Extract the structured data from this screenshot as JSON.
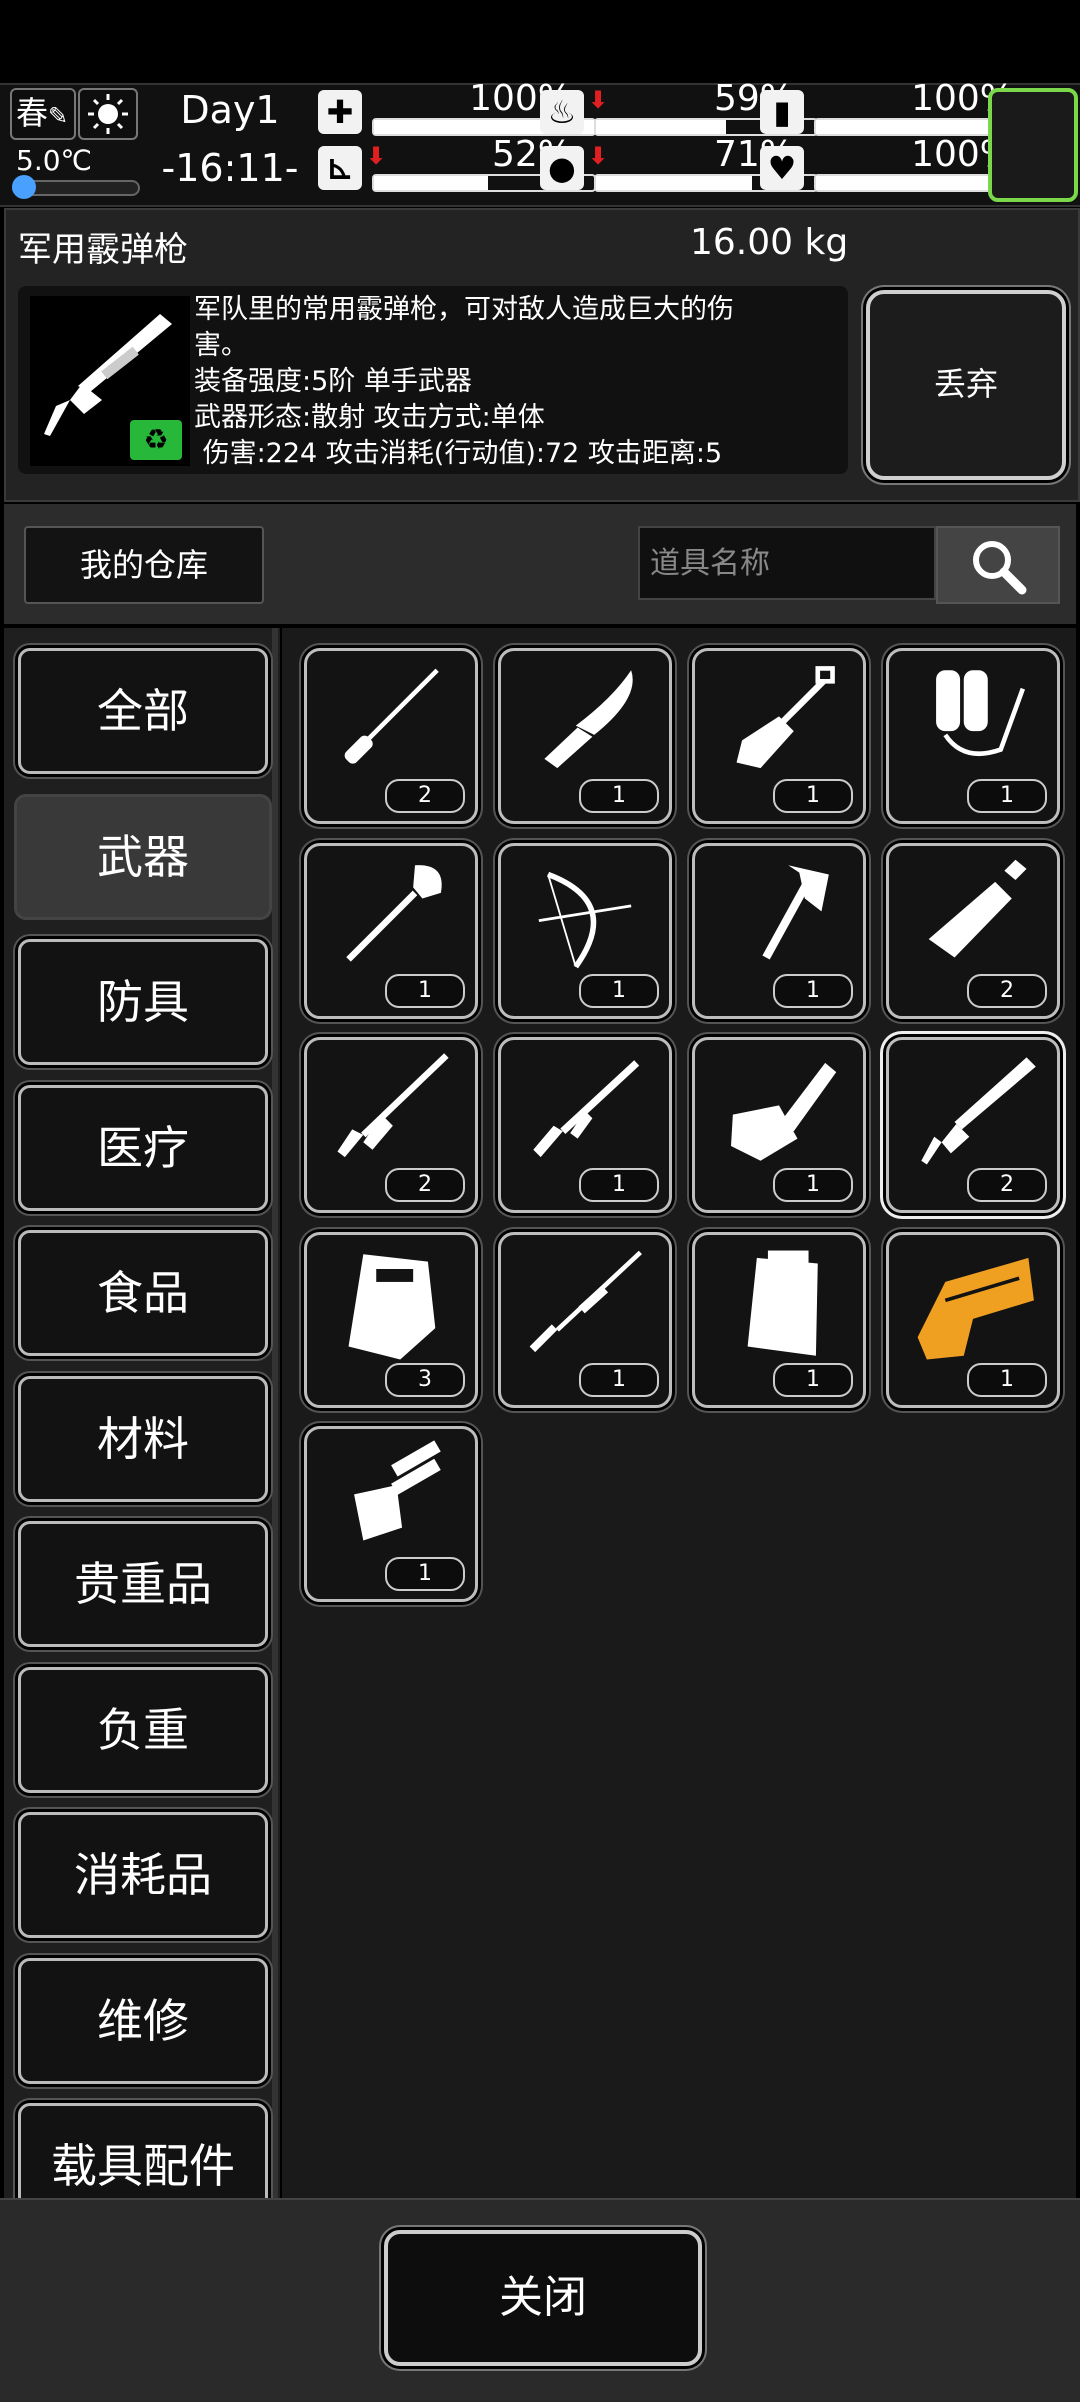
{
  "status": {
    "season": "春",
    "temperature": "5.0℃",
    "day": "Day1",
    "time": "-16:11-",
    "stats": [
      {
        "icon": "medkit-icon",
        "value": "100%",
        "level": 1.0,
        "arrow": false
      },
      {
        "icon": "stomach-icon",
        "value": "59%",
        "level": 0.59,
        "arrow": true
      },
      {
        "icon": "battery-icon",
        "value": "100%",
        "level": 1.0,
        "arrow": false
      },
      {
        "icon": "boot-icon",
        "value": "52%",
        "level": 0.52,
        "arrow": true
      },
      {
        "icon": "water-drop-icon",
        "value": "71%",
        "level": 0.71,
        "arrow": true
      },
      {
        "icon": "heart-icon",
        "value": "100%",
        "level": 1.0,
        "arrow": false
      }
    ]
  },
  "item": {
    "name": "军用霰弹枪",
    "weight": "16.00 kg",
    "desc_line1": "军队里的常用霰弹枪，可对敌人造成巨大的伤",
    "desc_line2": "害。",
    "desc_line3": "装备强度:5阶 单手武器",
    "desc_line4": "武器形态:散射 攻击方式:单体",
    "desc_line5": " 伤害:224 攻击消耗(行动值):72 攻击距离:5",
    "discard_label": "丢弃"
  },
  "toolbar": {
    "warehouse_label": "我的仓库",
    "search_placeholder": "道具名称"
  },
  "categories": [
    {
      "label": "全部",
      "active": false
    },
    {
      "label": "武器",
      "active": true
    },
    {
      "label": "防具",
      "active": false
    },
    {
      "label": "医疗",
      "active": false
    },
    {
      "label": "食品",
      "active": false
    },
    {
      "label": "材料",
      "active": false
    },
    {
      "label": "贵重品",
      "active": false
    },
    {
      "label": "负重",
      "active": false
    },
    {
      "label": "消耗品",
      "active": false
    },
    {
      "label": "维修",
      "active": false
    },
    {
      "label": "载具配件",
      "active": false
    }
  ],
  "items": [
    {
      "icon": "bayonet-icon",
      "count": "2"
    },
    {
      "icon": "knife-icon",
      "count": "1"
    },
    {
      "icon": "shovel-icon",
      "count": "1"
    },
    {
      "icon": "flamethrower-icon",
      "count": "1"
    },
    {
      "icon": "long-shovel-icon",
      "count": "1"
    },
    {
      "icon": "compound-bow-icon",
      "count": "1"
    },
    {
      "icon": "axe-icon",
      "count": "1"
    },
    {
      "icon": "sword-icon",
      "count": "2"
    },
    {
      "icon": "assault-rifle-icon",
      "count": "2"
    },
    {
      "icon": "rifle-icon",
      "count": "1"
    },
    {
      "icon": "chainsaw-icon",
      "count": "1"
    },
    {
      "icon": "shotgun-icon",
      "count": "2"
    },
    {
      "icon": "riot-shield-icon",
      "count": "3"
    },
    {
      "icon": "sniper-rifle-icon",
      "count": "1"
    },
    {
      "icon": "heavy-shield-icon",
      "count": "1"
    },
    {
      "icon": "golden-gun-icon",
      "count": "1"
    },
    {
      "icon": "minigun-icon",
      "count": "1"
    }
  ],
  "close_label": "关闭",
  "colors": {
    "accent_green": "#7bd84a",
    "warning_red": "#e02020",
    "golden_item": "#f0a020"
  }
}
